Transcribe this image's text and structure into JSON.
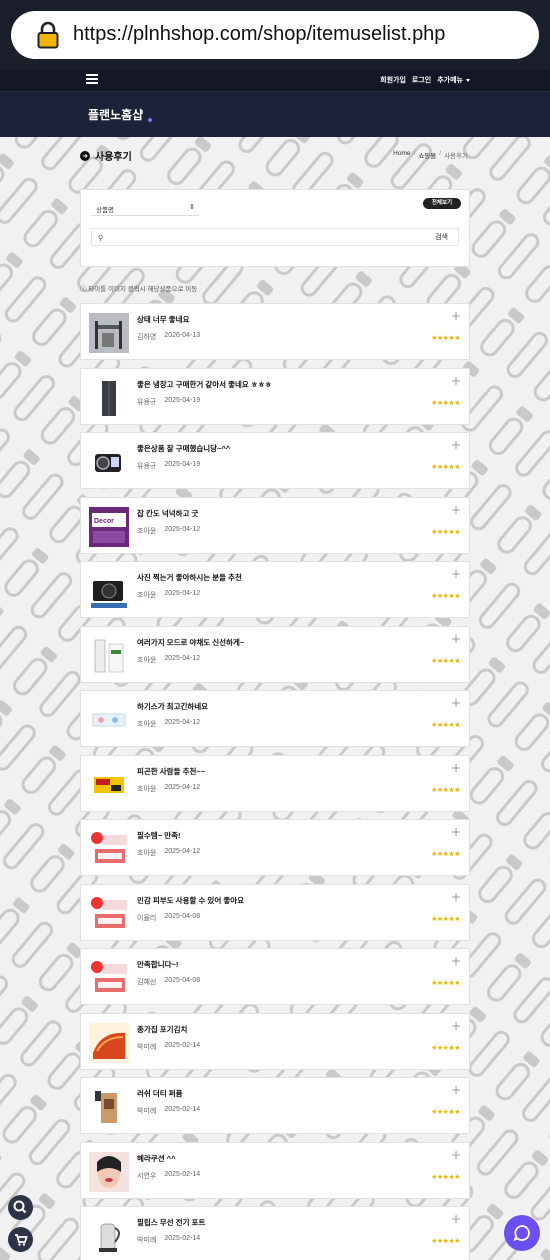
{
  "browser": {
    "url": "https://plnhshop.com/shop/itemuselist.php"
  },
  "topnav": {
    "links": [
      "회원가입",
      "로그인",
      "추가메뉴"
    ]
  },
  "brand": {
    "name": "플랜노홈샵"
  },
  "page": {
    "title": "사용후기",
    "breadcrumb": [
      "Home",
      "쇼핑몰",
      "사용후기"
    ]
  },
  "filter": {
    "select_value": "상품명",
    "all_button": "전체보기",
    "search_button": "검색"
  },
  "notice": "타이틀 이미지 클릭시 해당상품으로 이동",
  "reviews": [
    {
      "title": "상태 너무 좋네요",
      "author": "김하영",
      "date": "2026-04-13",
      "stars": "★★★★★",
      "thumb": "gym"
    },
    {
      "title": "좋은 냉장고 구매한거 같아서 좋네요 ㅎㅎㅎ",
      "author": "유용규",
      "date": "2025-04-19",
      "stars": "★★★★★",
      "thumb": "fridge"
    },
    {
      "title": "좋은상품 잘 구매했습니당~^^",
      "author": "유용규",
      "date": "2025-04-19",
      "stars": "★★★★★",
      "thumb": "camera"
    },
    {
      "title": "잡 칸도 넉넉하고 굿",
      "author": "조아윤",
      "date": "2025-04-12",
      "stars": "★★★★★",
      "thumb": "purple"
    },
    {
      "title": "사진 찍는거 좋아하시는 분들 추천",
      "author": "조아윤",
      "date": "2025-04-12",
      "stars": "★★★★★",
      "thumb": "dslr"
    },
    {
      "title": "여러가지 모드로 야채도 신선하게~",
      "author": "조아윤",
      "date": "2025-04-12",
      "stars": "★★★★★",
      "thumb": "appliance"
    },
    {
      "title": "하기스가 최고긴하네요",
      "author": "조아윤",
      "date": "2025-04-12",
      "stars": "★★★★★",
      "thumb": "diaper"
    },
    {
      "title": "피곤한 사람들 추천~~",
      "author": "조아윤",
      "date": "2025-04-12",
      "stars": "★★★★★",
      "thumb": "yellowbox"
    },
    {
      "title": "필수템~ 만족!",
      "author": "조아윤",
      "date": "2025-04-12",
      "stars": "★★★★★",
      "thumb": "redpack"
    },
    {
      "title": "민감 피부도 사용할 수 있어 좋아요",
      "author": "이율리",
      "date": "2025-04-08",
      "stars": "★★★★★",
      "thumb": "redpack"
    },
    {
      "title": "만족합니다~!",
      "author": "김혜선",
      "date": "2025-04-08",
      "stars": "★★★★★",
      "thumb": "redpack"
    },
    {
      "title": "종가집 포기김치",
      "author": "박미례",
      "date": "2025-02-14",
      "stars": "★★★★★",
      "thumb": "kimchi"
    },
    {
      "title": "러쉬 더티 퍼퓸",
      "author": "박미례",
      "date": "2025-02-14",
      "stars": "★★★★★",
      "thumb": "perfume"
    },
    {
      "title": "헤라쿠션 ^^",
      "author": "서연우",
      "date": "2025-02-14",
      "stars": "★★★★★",
      "thumb": "face"
    },
    {
      "title": "필립스 무선 전기 포트",
      "author": "박미례",
      "date": "2025-02-14",
      "stars": "★★★★★",
      "thumb": "kettle"
    }
  ],
  "icons": {
    "search": "search-icon",
    "cart": "cart-icon",
    "chat": "chat-icon"
  },
  "colors": {
    "header": "#121626",
    "brandbar": "#1c2238",
    "star": "#e8b400",
    "chat": "#6b4ff0"
  }
}
